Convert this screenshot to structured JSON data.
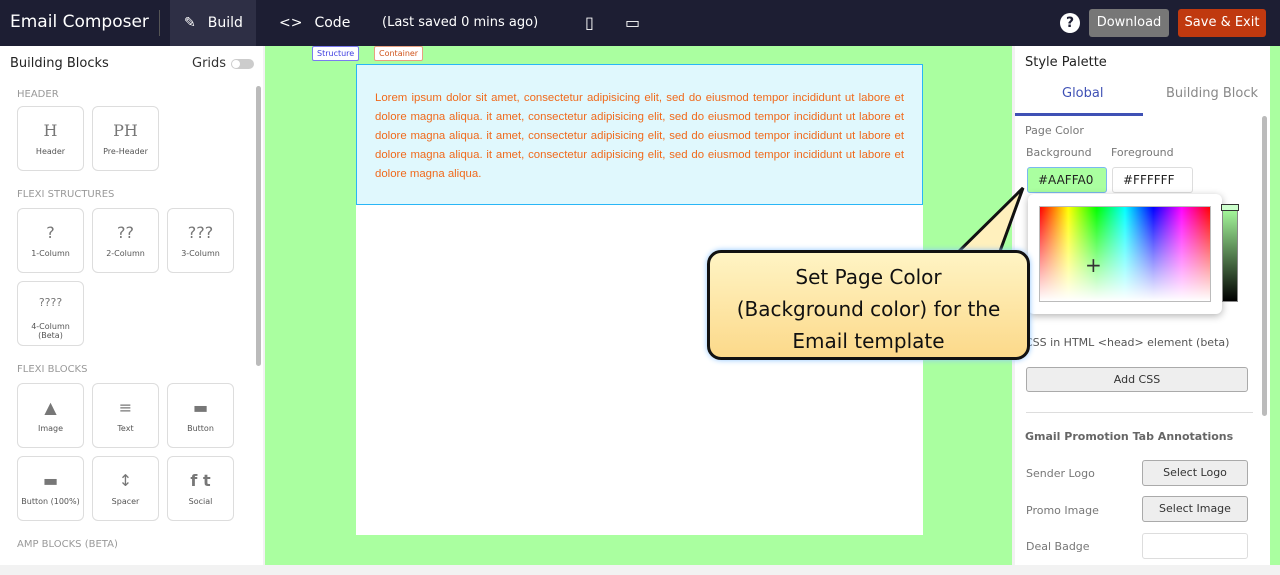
{
  "header": {
    "title": "Email Composer",
    "tabs": [
      {
        "label": "Build",
        "icon": "pencil-icon"
      },
      {
        "label": "Code",
        "icon": "code-icon"
      }
    ],
    "saved": "(Last saved 0 mins ago)",
    "help": "?",
    "download": "Download",
    "save_exit": "Save & Exit"
  },
  "left": {
    "title": "Building Blocks",
    "grids": "Grids",
    "sections": [
      {
        "title": "HEADER",
        "items": [
          {
            "icon": "H",
            "label": "Header"
          },
          {
            "icon": "PH",
            "label": "Pre-Header"
          }
        ]
      },
      {
        "title": "FLEXI STRUCTURES",
        "items": [
          {
            "icon": "?",
            "label": "1-Column"
          },
          {
            "icon": "??",
            "label": "2-Column"
          },
          {
            "icon": "???",
            "label": "3-Column"
          },
          {
            "icon": "????",
            "label": "4-Column (Beta)"
          }
        ]
      },
      {
        "title": "FLEXI BLOCKS",
        "items": [
          {
            "icon": "▲",
            "label": "Image"
          },
          {
            "icon": "≡",
            "label": "Text"
          },
          {
            "icon": "▬",
            "label": "Button"
          },
          {
            "icon": "▬",
            "label": "Button (100%)"
          },
          {
            "icon": "↕",
            "label": "Spacer"
          },
          {
            "icon": "f t",
            "label": "Social"
          }
        ]
      },
      {
        "title": "AMP BLOCKS (BETA)"
      }
    ]
  },
  "canvas": {
    "structure_label": "Structure",
    "container_label": "Container",
    "text": "Lorem ipsum dolor sit amet, consectetur adipisicing elit, sed do eiusmod tempor incididunt ut labore et dolore magna aliqua. it amet, consectetur adipisicing elit, sed do eiusmod tempor incididunt ut labore et dolore magna aliqua. it amet, consectetur adipisicing elit, sed do eiusmod tempor incididunt ut labore et dolore magna aliqua. it amet, consectetur adipisicing elit, sed do eiusmod tempor incididunt ut labore et dolore magna aliqua.",
    "page_color": "#AAFFA0"
  },
  "right": {
    "title": "Style Palette",
    "tabs": [
      "Global",
      "Building Block"
    ],
    "page_color": "Page Color",
    "background_label": "Background",
    "foreground_label": "Foreground",
    "background": "#AAFFA0",
    "foreground": "#FFFFFF",
    "css_label": "CSS in HTML <head> element (beta)",
    "add_css": "Add CSS",
    "gmail_title": "Gmail Promotion Tab Annotations",
    "sender_logo": "Sender Logo",
    "select_logo": "Select Logo",
    "promo_image": "Promo Image",
    "select_image": "Select Image",
    "deal_badge": "Deal Badge"
  },
  "callout": {
    "line1": "Set Page Color",
    "line2": "(Background color) for the",
    "line3": "Email template"
  }
}
